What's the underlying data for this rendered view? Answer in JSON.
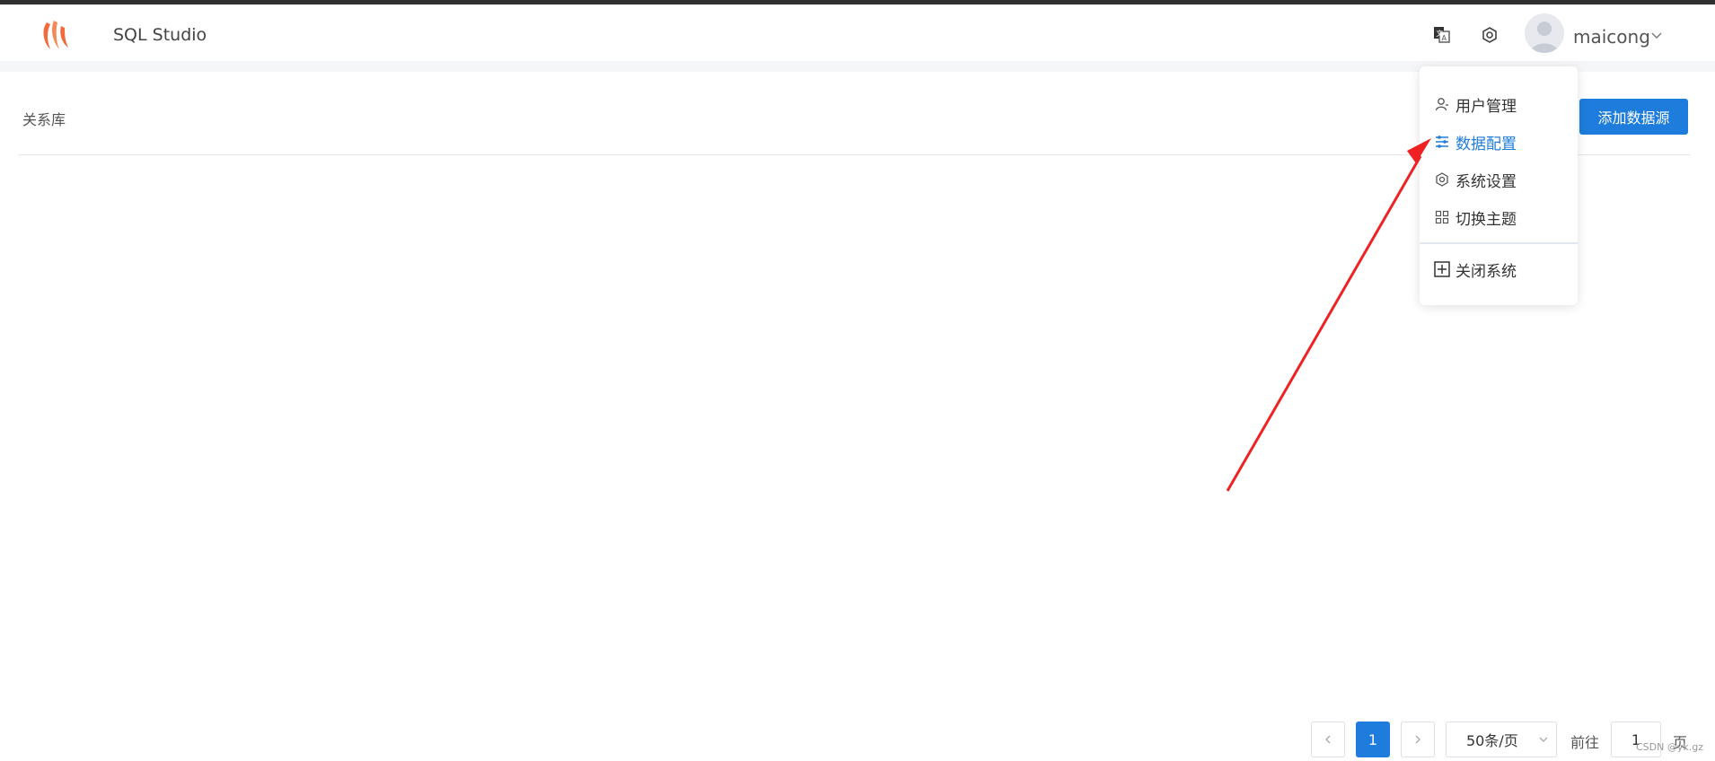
{
  "app": {
    "title": "SQL Studio"
  },
  "header": {
    "translate_icon": "translate-icon",
    "settings_icon": "gear-icon",
    "username": "maicong"
  },
  "page": {
    "section_title": "关系库",
    "add_button_label": "添加数据源"
  },
  "user_menu": {
    "items": [
      {
        "label": "用户管理",
        "icon": "user-icon",
        "active": false
      },
      {
        "label": "数据配置",
        "icon": "sliders-icon",
        "active": true
      },
      {
        "label": "系统设置",
        "icon": "gear-icon",
        "active": false
      },
      {
        "label": "切换主题",
        "icon": "grid-icon",
        "active": false
      }
    ],
    "footer_item": {
      "label": "关闭系统",
      "icon": "plus-square-icon"
    }
  },
  "pagination": {
    "current_page": "1",
    "page_size": "50条/页",
    "goto_label": "前往",
    "goto_value": "1",
    "page_suffix": "页"
  },
  "watermark": "CSDN @yk.gz",
  "colors": {
    "primary": "#1d7cdc",
    "logo": "#f26a3b",
    "arrow": "#ee2222"
  }
}
